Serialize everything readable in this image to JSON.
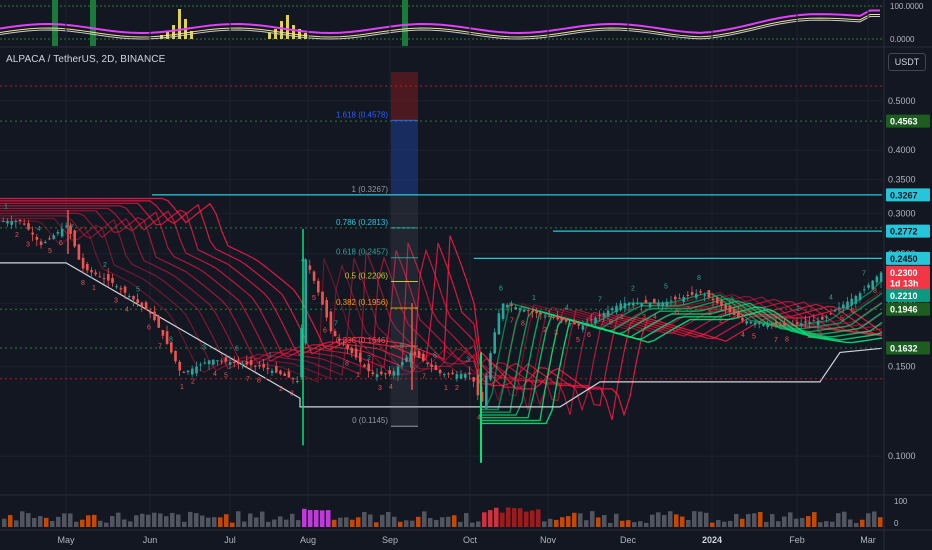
{
  "chart_data": {
    "type": "candlestick",
    "symbol_label": "ALPACA / TetherUS, 2D, BINANCE",
    "currency_button": "USDT",
    "x_ticks": [
      "May",
      "Jun",
      "Jul",
      "Aug",
      "Sep",
      "Oct",
      "Nov",
      "Dec",
      "2024",
      "Feb",
      "Mar"
    ],
    "y_ticks": [
      "0.5000",
      "0.4000",
      "0.3500",
      "0.3000",
      "0.2500",
      "0.2000",
      "0.1500",
      "0.1000"
    ],
    "y_scale": "log",
    "ylim": [
      0.085,
      0.57
    ],
    "fib_levels": [
      {
        "label": "1.618 (0.4578)",
        "value": 0.4578,
        "color": "#2962ff"
      },
      {
        "label": "1 (0.3267)",
        "value": 0.3267,
        "color": "#9598a1"
      },
      {
        "label": "0.786 (0.2813)",
        "value": 0.2813,
        "color": "#26c6da"
      },
      {
        "label": "0.618 (0.2457)",
        "value": 0.2457,
        "color": "#26a69a"
      },
      {
        "label": "0.5 (0.2206)",
        "value": 0.2206,
        "color": "#c0ca33"
      },
      {
        "label": "0.382 (0.1956)",
        "value": 0.1956,
        "color": "#ff9800"
      },
      {
        "label": "0.236 (0.1646)",
        "value": 0.1646,
        "color": "#ef5350"
      },
      {
        "label": "0 (0.1145)",
        "value": 0.1145,
        "color": "#9598a1"
      }
    ],
    "price_badges": [
      {
        "text": "0.4563",
        "value": 0.4563,
        "bg": "#1b5e20",
        "fg": "#ffffff"
      },
      {
        "text": "0.3267",
        "value": 0.3267,
        "bg": "#26c6da",
        "fg": "#131722"
      },
      {
        "text": "0.2772",
        "value": 0.2772,
        "bg": "#26c6da",
        "fg": "#131722"
      },
      {
        "text": "0.2450",
        "value": 0.245,
        "bg": "#26c6da",
        "fg": "#131722"
      },
      {
        "text": "0.2300",
        "value": 0.23,
        "bg": "#f23645",
        "fg": "#ffffff"
      },
      {
        "text": "1d 13h",
        "value": 0.219,
        "bg": "#f23645",
        "fg": "#ffffff"
      },
      {
        "text": "0.2210",
        "value": 0.207,
        "bg": "#089981",
        "fg": "#ffffff"
      },
      {
        "text": "0.1946",
        "value": 0.1946,
        "bg": "#1b5e20",
        "fg": "#ffffff"
      },
      {
        "text": "0.1632",
        "value": 0.1632,
        "bg": "#1b5e20",
        "fg": "#ffffff"
      }
    ],
    "osc_ticks": [
      "100.0000",
      "0.0000"
    ],
    "vol_ticks": [
      "100",
      "0"
    ],
    "sequence_labels": [
      "1",
      "2",
      "3",
      "4",
      "5",
      "6",
      "7",
      "8"
    ]
  }
}
